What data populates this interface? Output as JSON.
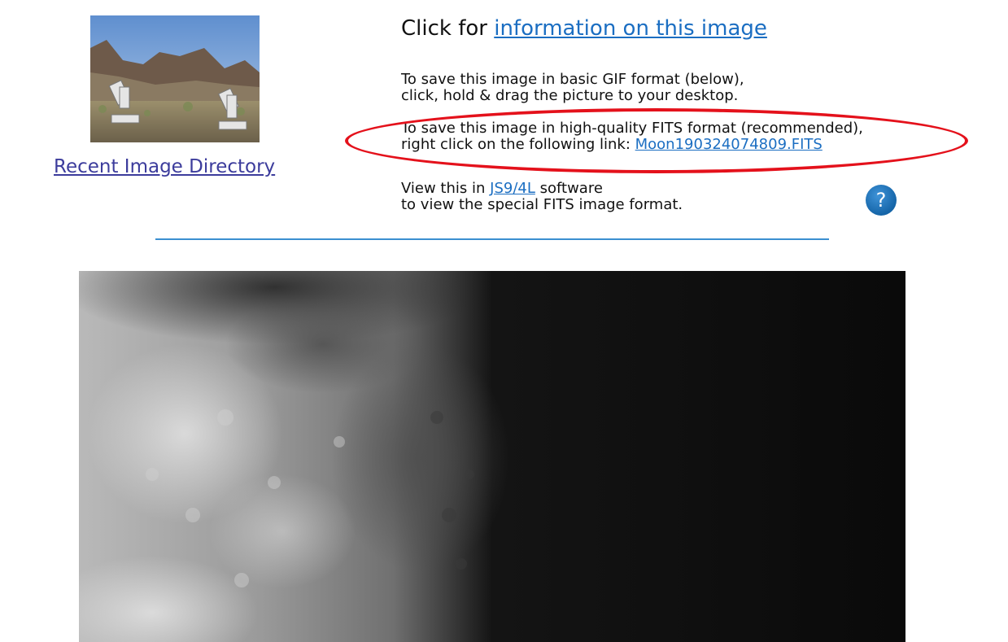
{
  "left": {
    "thumbnail_icon": "telescope-landscape-photo",
    "recent_link_label": "Recent Image Directory"
  },
  "info": {
    "title_prefix": "Click for ",
    "title_link": "information on this image",
    "gif_line1": "To save this image in basic GIF format (below),",
    "gif_line2": "click, hold & drag the picture to your desktop.",
    "fits_line1": "To save this image in high-quality FITS format (recommended),",
    "fits_line2_prefix": "right click on the following link: ",
    "fits_link": "Moon190324074809.FITS",
    "js9_prefix": "View this in ",
    "js9_link": "JS9/4L",
    "js9_suffix": " software",
    "js9_line2": "to view the special FITS image format.",
    "help_icon_glyph": "?"
  },
  "colors": {
    "link": "#1b6ec2",
    "visited_link": "#3c3c9c",
    "annotation": "#e4111b",
    "divider": "#3b8fd0",
    "help_icon": "#1565a8"
  },
  "main_image": {
    "subject": "moon-surface-image"
  }
}
